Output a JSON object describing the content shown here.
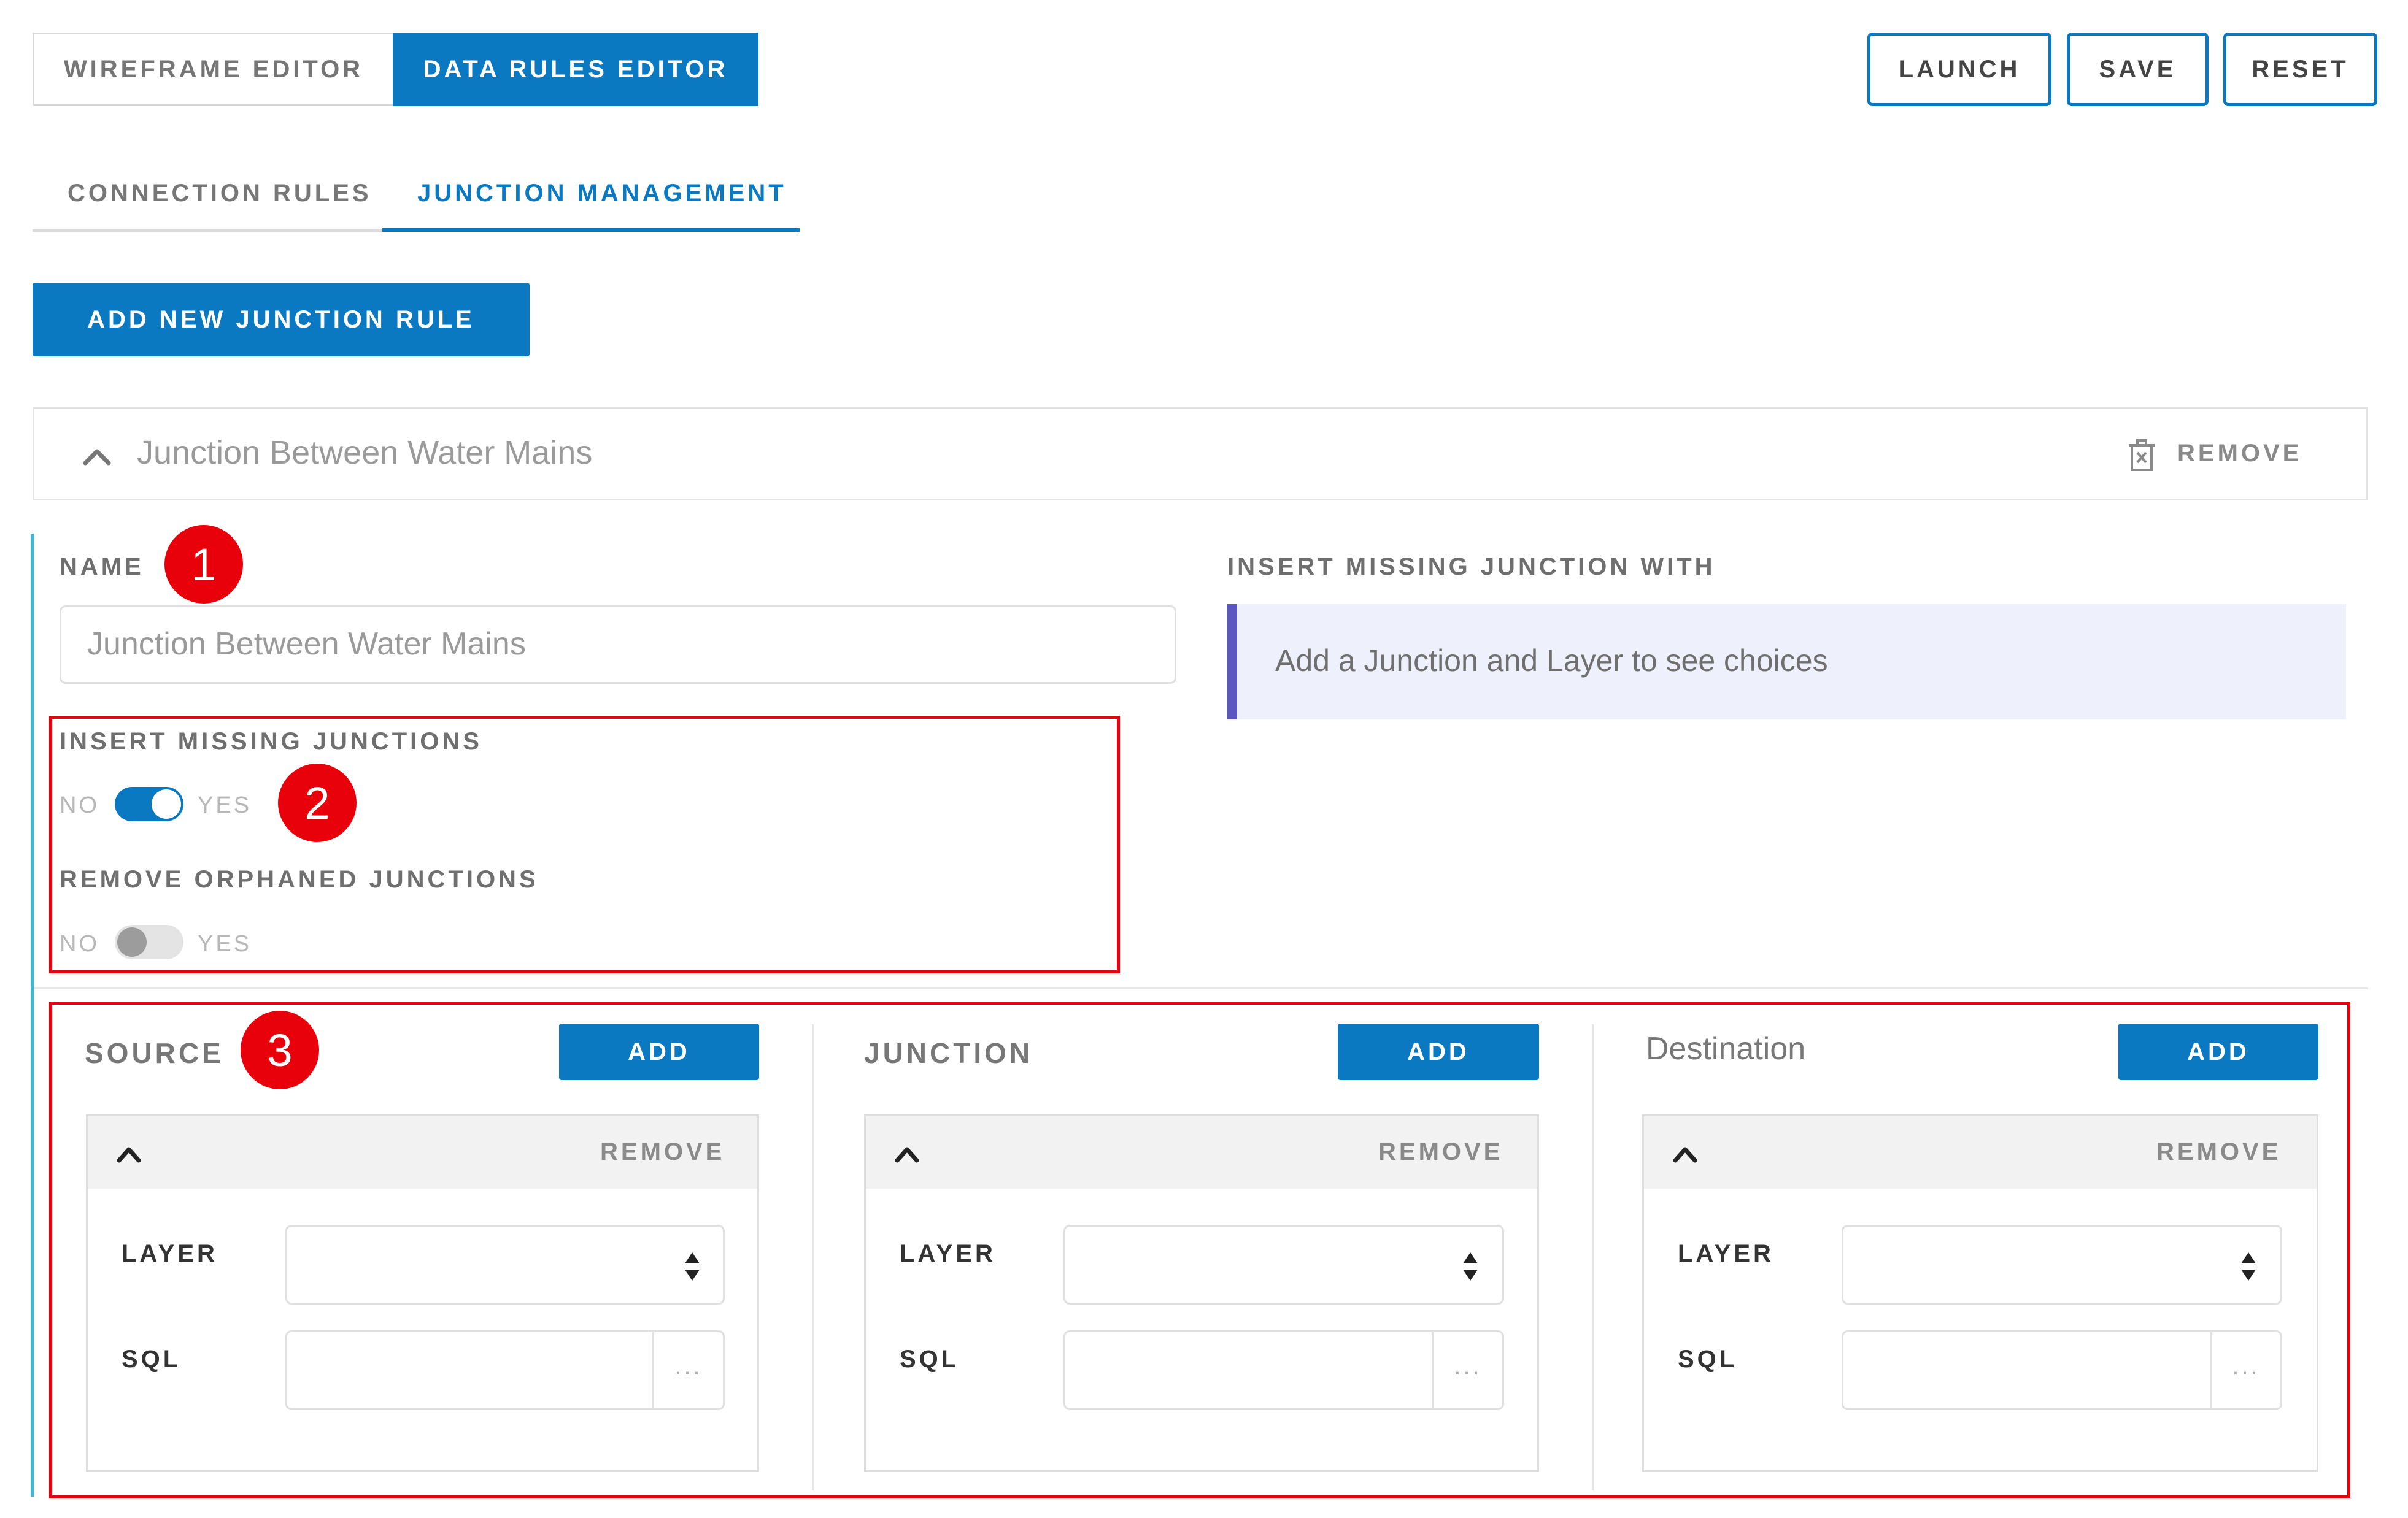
{
  "toolbar": {
    "wireframe_tab": "WIREFRAME EDITOR",
    "data_rules_tab": "DATA RULES EDITOR",
    "launch": "LAUNCH",
    "save": "SAVE",
    "reset": "RESET"
  },
  "subtabs": {
    "connection_rules": "CONNECTION RULES",
    "junction_management": "JUNCTION MANAGEMENT",
    "active": "junction_management"
  },
  "add_rule_button": "ADD NEW JUNCTION RULE",
  "rule": {
    "title": "Junction Between Water Mains",
    "remove": "REMOVE",
    "name_label": "NAME",
    "name_value": "Junction Between Water Mains",
    "insert_with_label": "INSERT MISSING JUNCTION WITH",
    "insert_with_hint": "Add a Junction and Layer to see choices",
    "insert_missing": {
      "label": "INSERT MISSING JUNCTIONS",
      "no": "NO",
      "yes": "YES",
      "on": true
    },
    "remove_orphaned": {
      "label": "REMOVE ORPHANED JUNCTIONS",
      "no": "NO",
      "yes": "YES",
      "on": false
    }
  },
  "columns": [
    {
      "title": "SOURCE",
      "add": "ADD",
      "remove": "REMOVE",
      "layer_label": "LAYER",
      "sql_label": "SQL",
      "sql_button": "..."
    },
    {
      "title": "JUNCTION",
      "add": "ADD",
      "remove": "REMOVE",
      "layer_label": "LAYER",
      "sql_label": "SQL",
      "sql_button": "..."
    },
    {
      "title": "Destination",
      "add": "ADD",
      "remove": "REMOVE",
      "layer_label": "LAYER",
      "sql_label": "SQL",
      "sql_button": "..."
    }
  ],
  "callouts": [
    "1",
    "2",
    "3"
  ],
  "colors": {
    "accent": "#0a79c2",
    "callout": "#e8000b",
    "hint_bar": "#5b56c0",
    "hint_bg": "#eef1fc"
  }
}
